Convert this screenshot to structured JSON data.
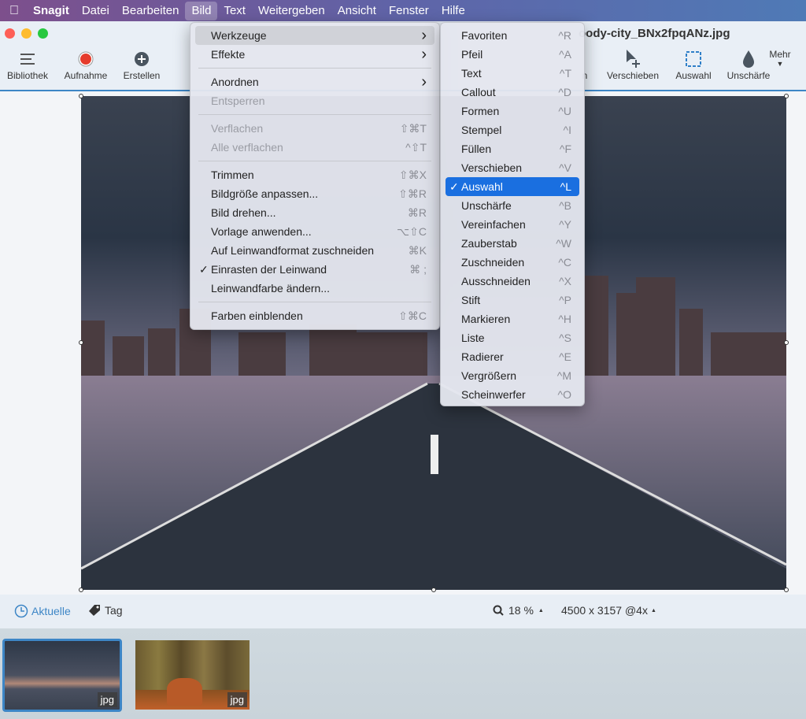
{
  "menubar": {
    "apple": "",
    "items": [
      "Snagit",
      "Datei",
      "Bearbeiten",
      "Bild",
      "Text",
      "Weitergeben",
      "Ansicht",
      "Fenster",
      "Hilfe"
    ],
    "active": "Bild"
  },
  "window": {
    "title": "oody-city_BNx2fpqANz.jpg"
  },
  "toolbar": {
    "left": [
      {
        "label": "Bibliothek",
        "icon": "list-icon"
      },
      {
        "label": "Aufnahme",
        "icon": "record-icon"
      },
      {
        "label": "Erstellen",
        "icon": "plus-circle-icon"
      }
    ],
    "right": [
      {
        "label": "n",
        "icon": "hidden-tool-icon"
      },
      {
        "label": "Verschieben",
        "icon": "move-pointer-icon"
      },
      {
        "label": "Auswahl",
        "icon": "selection-icon"
      },
      {
        "label": "Unschärfe",
        "icon": "blur-drop-icon"
      }
    ],
    "more": "Mehr"
  },
  "bild_menu": [
    {
      "label": "Werkzeuge",
      "submenu": true,
      "highlighted": true
    },
    {
      "label": "Effekte",
      "submenu": true
    },
    {
      "sep": true
    },
    {
      "label": "Anordnen",
      "submenu": true
    },
    {
      "label": "Entsperren",
      "disabled": true
    },
    {
      "sep": true
    },
    {
      "label": "Verflachen",
      "shortcut": "⇧⌘T",
      "disabled": true
    },
    {
      "label": "Alle verflachen",
      "shortcut": "^⇧T",
      "disabled": true
    },
    {
      "sep": true
    },
    {
      "label": "Trimmen",
      "shortcut": "⇧⌘X"
    },
    {
      "label": "Bildgröße anpassen...",
      "shortcut": "⇧⌘R"
    },
    {
      "label": "Bild drehen...",
      "shortcut": "⌘R"
    },
    {
      "label": "Vorlage anwenden...",
      "shortcut": "⌥⇧C"
    },
    {
      "label": "Auf Leinwandformat zuschneiden",
      "shortcut": "⌘K"
    },
    {
      "label": "Einrasten der Leinwand",
      "shortcut": "⌘ ;",
      "checked": true
    },
    {
      "label": "Leinwandfarbe ändern..."
    },
    {
      "sep": true
    },
    {
      "label": "Farben einblenden",
      "shortcut": "⇧⌘C"
    }
  ],
  "werkzeuge_menu": [
    {
      "label": "Favoriten",
      "shortcut": "^R"
    },
    {
      "label": "Pfeil",
      "shortcut": "^A"
    },
    {
      "label": "Text",
      "shortcut": "^T"
    },
    {
      "label": "Callout",
      "shortcut": "^D"
    },
    {
      "label": "Formen",
      "shortcut": "^U"
    },
    {
      "label": "Stempel",
      "shortcut": "^I"
    },
    {
      "label": "Füllen",
      "shortcut": "^F"
    },
    {
      "label": "Verschieben",
      "shortcut": "^V"
    },
    {
      "label": "Auswahl",
      "shortcut": "^L",
      "checked": true,
      "selected": true
    },
    {
      "label": "Unschärfe",
      "shortcut": "^B"
    },
    {
      "label": "Vereinfachen",
      "shortcut": "^Y"
    },
    {
      "label": "Zauberstab",
      "shortcut": "^W"
    },
    {
      "label": "Zuschneiden",
      "shortcut": "^C"
    },
    {
      "label": "Ausschneiden",
      "shortcut": "^X"
    },
    {
      "label": "Stift",
      "shortcut": "^P"
    },
    {
      "label": "Markieren",
      "shortcut": "^H"
    },
    {
      "label": "Liste",
      "shortcut": "^S"
    },
    {
      "label": "Radierer",
      "shortcut": "^E"
    },
    {
      "label": "Vergrößern",
      "shortcut": "^M"
    },
    {
      "label": "Scheinwerfer",
      "shortcut": "^O"
    }
  ],
  "bottombar": {
    "recent": "Aktuelle",
    "tag": "Tag",
    "zoom": "18 %",
    "dimensions": "4500 x 3157 @4x"
  },
  "tray": [
    {
      "badge": "jpg",
      "selected": true
    },
    {
      "badge": "jpg"
    }
  ],
  "colors": {
    "accent": "#3d86c6",
    "selection": "#1a6fe0",
    "record": "#e53b2c"
  }
}
